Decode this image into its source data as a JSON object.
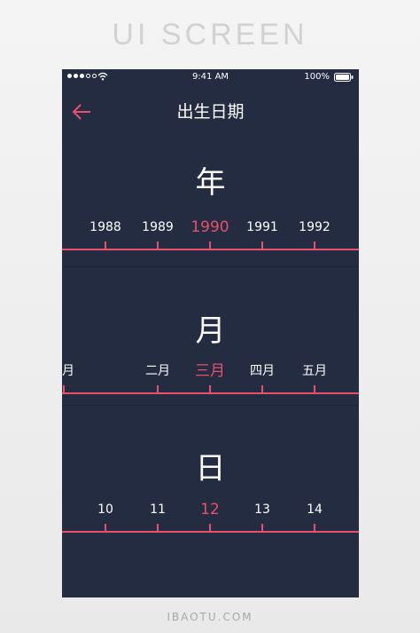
{
  "page": {
    "header": "UI SCREEN",
    "footer": "IBAOTU.COM"
  },
  "status_bar": {
    "time": "9:41 AM",
    "battery": "100%"
  },
  "nav": {
    "title": "出生日期"
  },
  "colors": {
    "background": "#232c40",
    "accent": "#e8506b",
    "text": "#ffffff"
  },
  "icons": {
    "back": "arrow-left-icon",
    "wifi": "wifi-icon",
    "battery": "battery-icon"
  },
  "year_picker": {
    "title": "年",
    "items": [
      "1988",
      "1989",
      "1990",
      "1991",
      "1992"
    ],
    "selected": "1990"
  },
  "month_picker": {
    "title": "月",
    "items": [
      "月",
      "二月",
      "三月",
      "四月",
      "五月"
    ],
    "selected": "三月"
  },
  "day_picker": {
    "title": "日",
    "items": [
      "10",
      "11",
      "12",
      "13",
      "14"
    ],
    "selected": "12"
  }
}
